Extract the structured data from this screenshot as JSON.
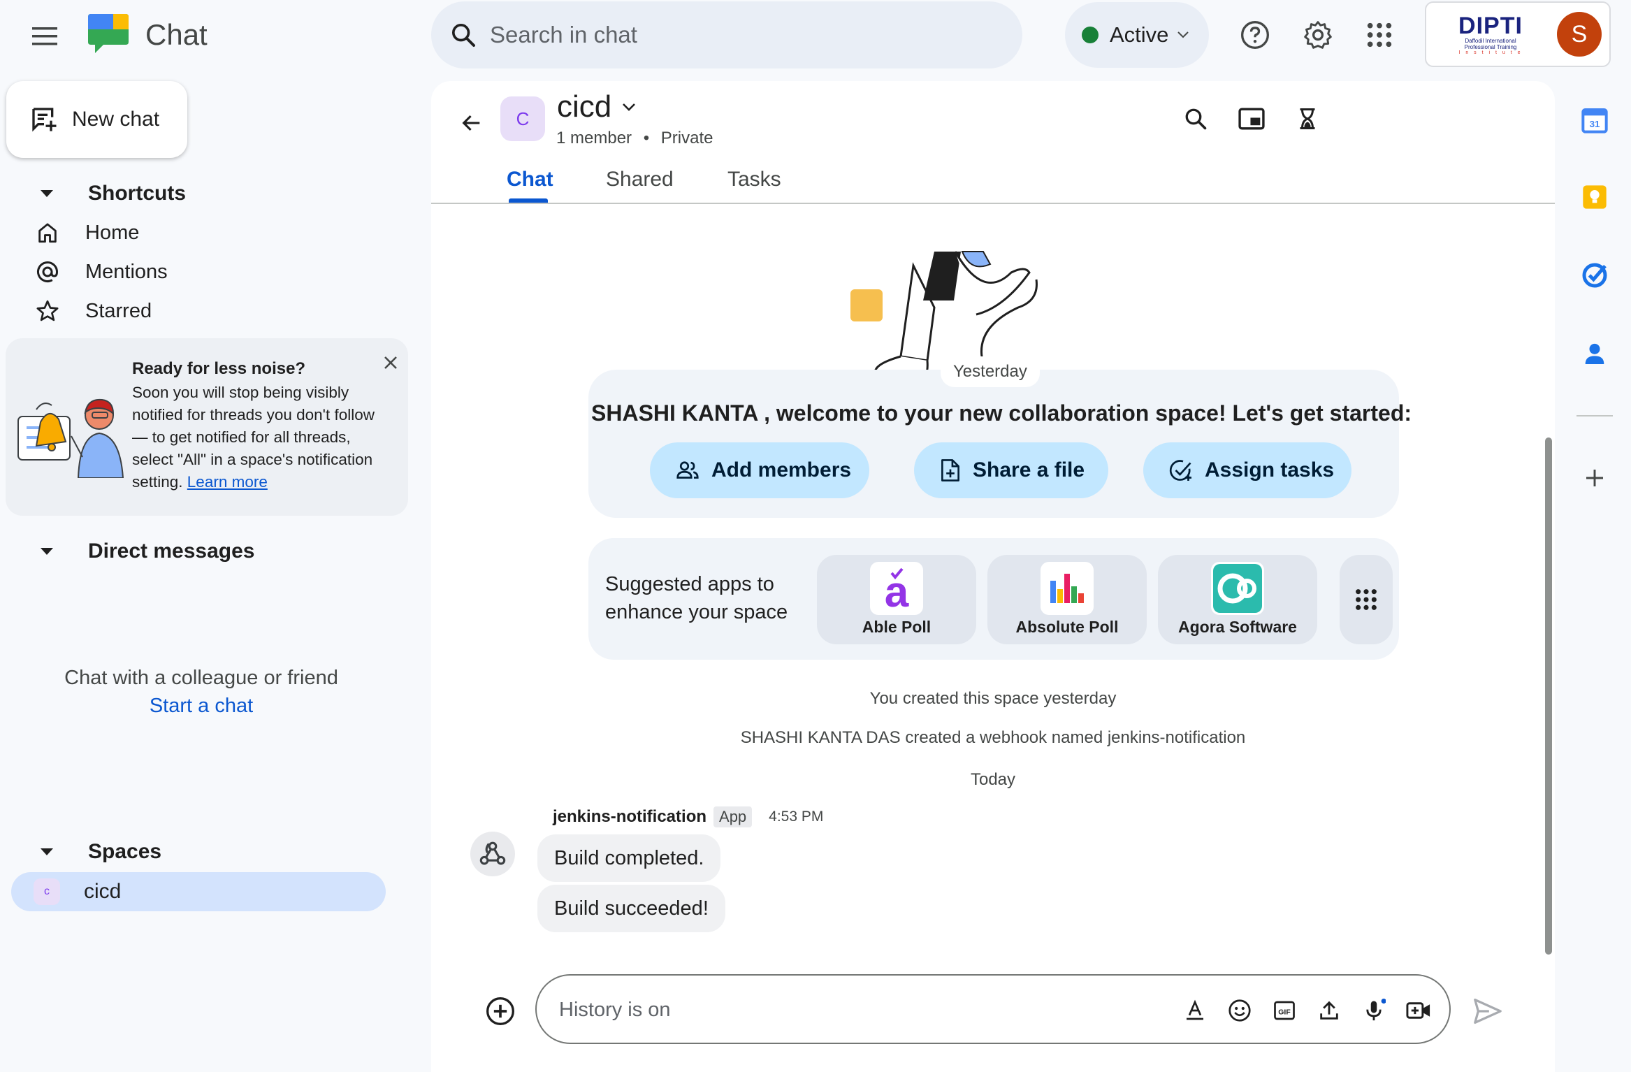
{
  "app": {
    "title": "Chat"
  },
  "search": {
    "placeholder": "Search in chat"
  },
  "status": {
    "label": "Active",
    "color": "#188038"
  },
  "org_logo": {
    "name": "DIPTI",
    "subtitle_line1": "Daffodil International",
    "subtitle_line2": "Professional Training",
    "subtitle_line3": "I n s t i t u t e"
  },
  "user": {
    "initial": "S",
    "avatar_color": "#c2410c"
  },
  "sidebar": {
    "new_chat": "New chat",
    "shortcuts": {
      "heading": "Shortcuts",
      "items": [
        {
          "label": "Home",
          "icon": "home-icon"
        },
        {
          "label": "Mentions",
          "icon": "at-icon"
        },
        {
          "label": "Starred",
          "icon": "star-icon"
        }
      ]
    },
    "noise_card": {
      "title": "Ready for less noise?",
      "body": "Soon you will stop being visibly notified for threads you don't follow — to get notified for all threads, select \"All\" in a space's notification setting. ",
      "link": "Learn more"
    },
    "direct_messages": {
      "heading": "Direct messages",
      "empty_text": "Chat with a colleague or friend",
      "start_link": "Start a chat"
    },
    "spaces": {
      "heading": "Spaces",
      "items": [
        {
          "initial": "c",
          "label": "cicd",
          "selected": true
        }
      ]
    }
  },
  "room": {
    "initial": "C",
    "name": "cicd",
    "member_count": "1 member",
    "visibility": "Private",
    "separator": "•",
    "tabs": [
      {
        "label": "Chat",
        "active": true
      },
      {
        "label": "Shared"
      },
      {
        "label": "Tasks"
      }
    ]
  },
  "welcome": {
    "day_label": "Yesterday",
    "text": "SHASHI KANTA , welcome to your new collaboration space! Let's get started:",
    "actions": [
      {
        "label": "Add members",
        "icon": "people-icon"
      },
      {
        "label": "Share a file",
        "icon": "file-add-icon"
      },
      {
        "label": "Assign tasks",
        "icon": "task-check-icon"
      }
    ]
  },
  "suggested_apps": {
    "label_line1": "Suggested apps to",
    "label_line2": "enhance your space",
    "apps": [
      {
        "name": "Able Poll"
      },
      {
        "name": "Absolute Poll"
      },
      {
        "name": "Agora Software"
      }
    ]
  },
  "system_messages": {
    "created": "You created this space yesterday",
    "webhook": "SHASHI KANTA DAS created a webhook named jenkins-notification",
    "today": "Today"
  },
  "message": {
    "sender": "jenkins-notification",
    "badge": "App",
    "time": "4:53 PM",
    "bubbles": [
      "Build completed.",
      "Build succeeded!"
    ]
  },
  "composer": {
    "placeholder": "History is on"
  },
  "colors": {
    "accent": "#0b57d0",
    "selection": "#d3e3fd",
    "chip": "#c2e7ff"
  }
}
